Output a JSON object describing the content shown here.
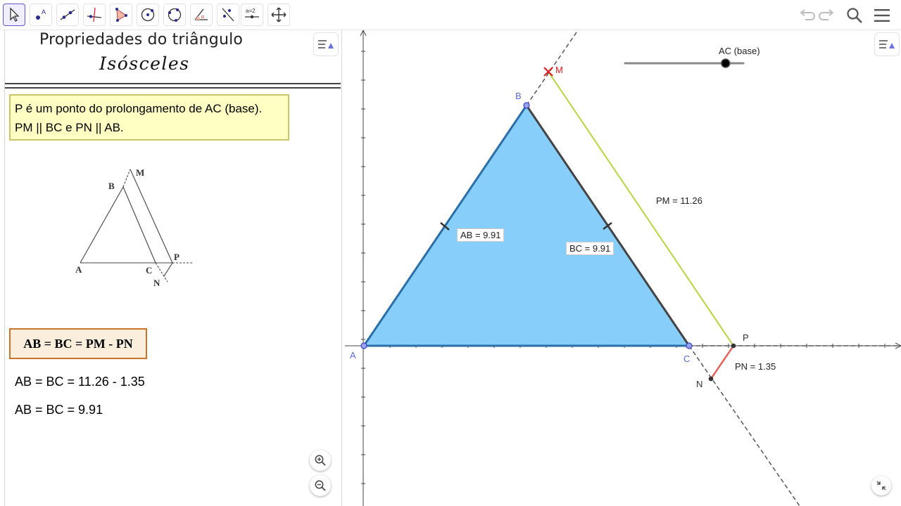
{
  "toolbar": {
    "tools": [
      {
        "name": "move-tool",
        "label": "Move",
        "active": true
      },
      {
        "name": "point-tool",
        "label": "Point"
      },
      {
        "name": "line-tool",
        "label": "Line"
      },
      {
        "name": "perpendicular-tool",
        "label": "Perpendicular Line"
      },
      {
        "name": "polygon-tool",
        "label": "Polygon"
      },
      {
        "name": "circle-tool",
        "label": "Circle"
      },
      {
        "name": "circle-three-points-tool",
        "label": "Circle through 3 Points"
      },
      {
        "name": "angle-tool",
        "label": "Angle"
      },
      {
        "name": "reflect-tool",
        "label": "Reflect about Line"
      },
      {
        "name": "slider-tool",
        "label": "a=2"
      },
      {
        "name": "move-graphics-tool",
        "label": "Move Graphics View"
      }
    ],
    "right": [
      "undo-icon",
      "redo-icon",
      "search-icon",
      "menu-icon"
    ]
  },
  "left": {
    "title_line1": "Propriedades do triângulo",
    "title_line2": "Isósceles",
    "yellow_box": {
      "line1": "P é um ponto do prolongamento de AC (base).",
      "line2": "PM || BC e PN || AB."
    },
    "sketch_labels": {
      "B": "B",
      "M": "M",
      "A": "A",
      "C": "C",
      "P": "P",
      "N": "N"
    },
    "formula": "AB = BC = PM - PN",
    "calc1": "AB =  BC = 11.26 - 1.35",
    "calc2": "AB =  BC = 9.91"
  },
  "graphics": {
    "slider_label": "AC (base)",
    "slider_value_fraction": 0.85,
    "points": {
      "A": "A",
      "B": "B",
      "C": "C",
      "P": "P",
      "M": "M",
      "N": "N"
    },
    "measures": {
      "AB": "AB = 9.91",
      "BC": "BC = 9.91",
      "PM": "PM = 11.26",
      "PN": "PN = 1.35"
    },
    "colors": {
      "triangle_fill": "#87cefa",
      "triangle_edge": "#2a6fa8",
      "pm_segment": "#b5d541",
      "pn_segment": "#e0605a",
      "point": "#6b72e0",
      "point_M": "#e02020"
    }
  }
}
